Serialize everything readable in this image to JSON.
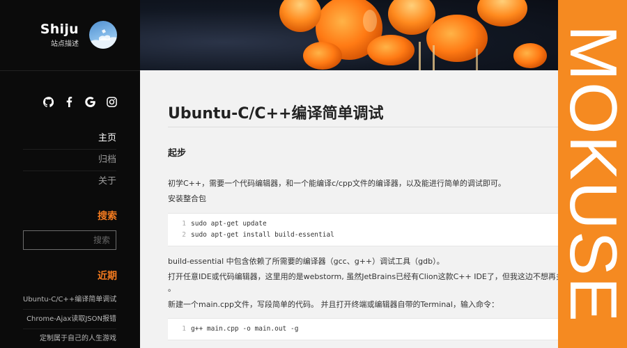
{
  "site": {
    "title": "Shiju",
    "description": "站点描述"
  },
  "social": [
    {
      "icon": "github-icon"
    },
    {
      "icon": "facebook-icon"
    },
    {
      "icon": "google-icon"
    },
    {
      "icon": "instagram-icon"
    }
  ],
  "nav": [
    {
      "label": "主页",
      "active": true
    },
    {
      "label": "归档",
      "active": false
    },
    {
      "label": "关于",
      "active": false
    }
  ],
  "search": {
    "title": "搜索",
    "placeholder": "搜索"
  },
  "recent": {
    "title": "近期",
    "items": [
      {
        "label": "Ubuntu-C/C++编译简单调试"
      },
      {
        "label": "Chrome-Ajax读取JSON报错"
      },
      {
        "label": "定制属于自己的人生游戏"
      }
    ]
  },
  "post": {
    "title": "Ubuntu-C/C++编译简单调试",
    "section1": "起步",
    "p1": "初学C++，需要一个代码编辑器，和一个能编译c/cpp文件的编译器，以及能进行简单的调试即可。",
    "p2": "安装整合包",
    "code1": [
      {
        "num": "1",
        "text": "sudo apt-get update"
      },
      {
        "num": "2",
        "text": "sudo apt-get install build-essential"
      }
    ],
    "p3": "build-essential 中包含依赖了所需要的编译器（gcc、g++）调试工具（gdb）。",
    "p4": "打开任意IDE或代码编辑器，这里用的是webstorm, 虽然JetBrains已经有Clion这款C++ IDE了，但我这边不想再多",
    "p4b": "。",
    "p5": "新建一个main.cpp文件，写段简单的代码。 并且打开终端或编辑器自带的Terminal，输入命令：",
    "code2": [
      {
        "num": "1",
        "text": "g++ main.cpp -o main.out -g"
      }
    ]
  },
  "brand": {
    "text": "MOKUSE",
    "color": "#f58a21"
  },
  "colors": {
    "accent": "#f47b1f",
    "sidebar_bg": "#0b0b0b",
    "content_bg": "#f2f2f2"
  }
}
